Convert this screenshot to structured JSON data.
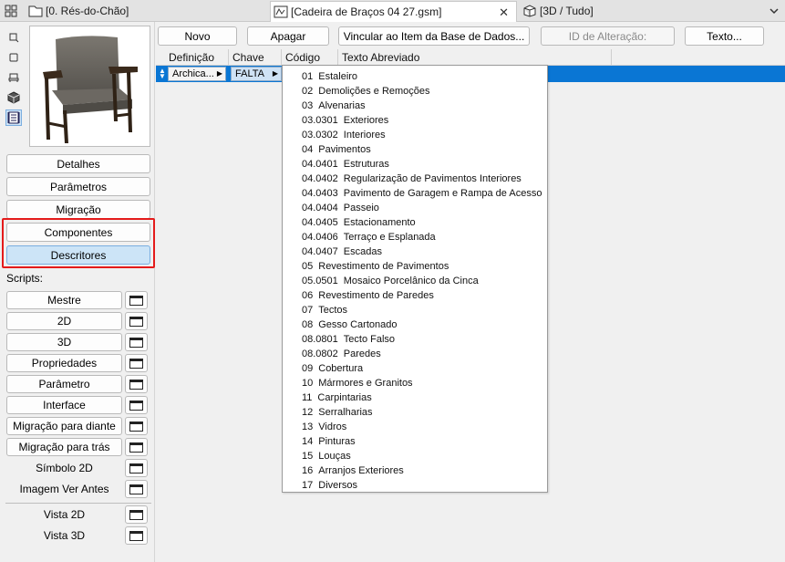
{
  "tabs": [
    {
      "label": "[0. Rés-do-Chão]",
      "icon": "floor-plan-icon"
    },
    {
      "label": "[Cadeira de Braços 04 27.gsm]",
      "icon": "gdl-editor-icon",
      "close": "✕"
    },
    {
      "label": "[3D / Tudo]",
      "icon": "3d-view-icon"
    }
  ],
  "left": {
    "nav": [
      "Detalhes",
      "Parâmetros",
      "Migração",
      "Componentes",
      "Descritores"
    ],
    "selected_nav": "Descritores",
    "scripts_label": "Scripts:",
    "scripts": [
      "Mestre",
      "2D",
      "3D",
      "Propriedades",
      "Parâmetro",
      "Interface",
      "Migração para diante",
      "Migração para trás",
      "Símbolo 2D",
      "Imagem Ver Antes",
      "Vista 2D",
      "Vista 3D"
    ]
  },
  "toolbar": {
    "new": "Novo",
    "delete": "Apagar",
    "link": "Vincular ao Item da Base de Dados...",
    "change_id": "ID de Alteração:",
    "text": "Texto..."
  },
  "table": {
    "headers": [
      "Definição",
      "Chave",
      "Código",
      "Texto Abreviado"
    ],
    "row": {
      "definition": "Archica...",
      "key": "FALTA"
    }
  },
  "dropdown": [
    {
      "code": "01",
      "text": "Estaleiro"
    },
    {
      "code": "02",
      "text": "Demolições e Remoções"
    },
    {
      "code": "03",
      "text": "Alvenarias"
    },
    {
      "code": "03.0301",
      "text": "Exteriores"
    },
    {
      "code": "03.0302",
      "text": "Interiores"
    },
    {
      "code": "04",
      "text": "Pavimentos"
    },
    {
      "code": "04.0401",
      "text": "Estruturas"
    },
    {
      "code": "04.0402",
      "text": "Regularização de Pavimentos Interiores"
    },
    {
      "code": "04.0403",
      "text": "Pavimento de Garagem e Rampa de Acesso"
    },
    {
      "code": "04.0404",
      "text": "Passeio"
    },
    {
      "code": "04.0405",
      "text": "Estacionamento"
    },
    {
      "code": "04.0406",
      "text": "Terraço e Esplanada"
    },
    {
      "code": "04.0407",
      "text": "Escadas"
    },
    {
      "code": "05",
      "text": "Revestimento de Pavimentos"
    },
    {
      "code": "05.0501",
      "text": "Mosaico Porcelânico da Cinca"
    },
    {
      "code": "06",
      "text": "Revestimento de Paredes"
    },
    {
      "code": "07",
      "text": "Tectos"
    },
    {
      "code": "08",
      "text": "Gesso Cartonado"
    },
    {
      "code": "08.0801",
      "text": "Tecto Falso"
    },
    {
      "code": "08.0802",
      "text": "Paredes"
    },
    {
      "code": "09",
      "text": "Cobertura"
    },
    {
      "code": "10",
      "text": "Mármores e Granitos"
    },
    {
      "code": "11",
      "text": "Carpintarias"
    },
    {
      "code": "12",
      "text": "Serralharias"
    },
    {
      "code": "13",
      "text": "Vidros"
    },
    {
      "code": "14",
      "text": "Pinturas"
    },
    {
      "code": "15",
      "text": "Louças"
    },
    {
      "code": "16",
      "text": "Arranjos Exteriores"
    },
    {
      "code": "17",
      "text": "Diversos"
    }
  ],
  "colors": {
    "selection": "#0a76d4",
    "highlight": "#e41b1b",
    "selected_button": "#cce4f7"
  }
}
